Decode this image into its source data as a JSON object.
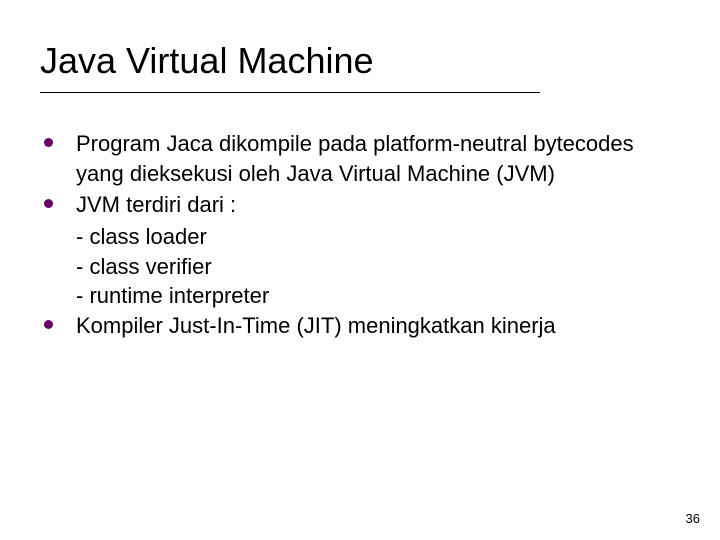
{
  "title": "Java Virtual Machine",
  "bullets": {
    "b1": "Program Jaca dikompile pada platform-neutral bytecodes yang dieksekusi oleh Java Virtual Machine (JVM)",
    "b2": "JVM terdiri dari :",
    "b2_sub1": "- class loader",
    "b2_sub2": "- class verifier",
    "b2_sub3": "- runtime interpreter",
    "b3": "Kompiler Just-In-Time (JIT) meningkatkan kinerja"
  },
  "page_number": "36"
}
